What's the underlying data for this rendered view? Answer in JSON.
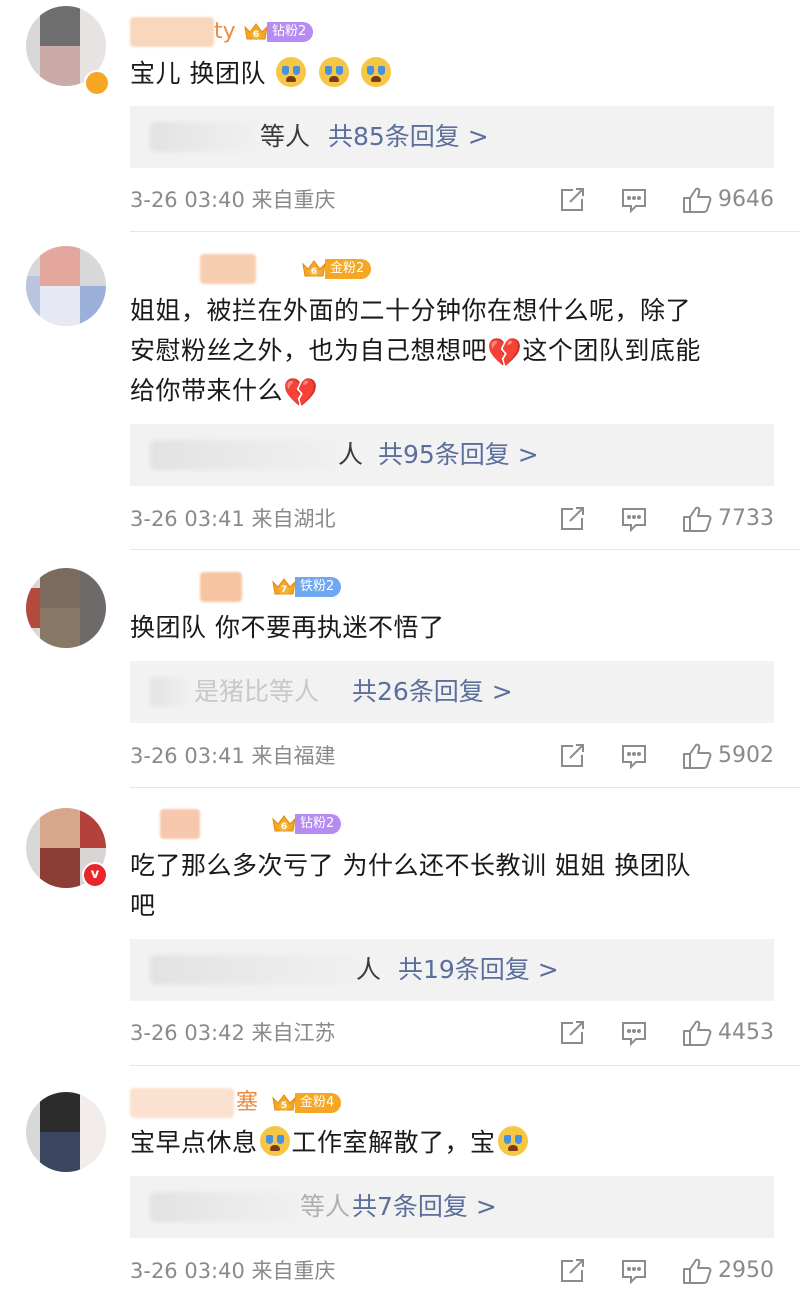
{
  "comments": [
    {
      "username_visible": "ty",
      "fan_badge": {
        "level": "6",
        "label": "钻粉2",
        "color": "#b68cf3",
        "crown": "#f5a623"
      },
      "text": "宝儿 换团队",
      "emojis": [
        "crying-face",
        "crying-face",
        "crying-face"
      ],
      "reply_suffix": "等人",
      "reply_link": "共85条回复 >",
      "time": "3-26 03:40 来自重庆",
      "likes": "9646"
    },
    {
      "username_visible": "",
      "fan_badge": {
        "level": "6",
        "label": "金粉2",
        "color": "#f5a623",
        "crown": "#f5a623"
      },
      "text_line1": "姐姐，被拦在外面的二十分钟你在想什么呢，除了",
      "text_line2a": "安慰粉丝之外，也为自己想想吧",
      "text_line2b": "这个团队到底能",
      "text_line3": "给你带来什么",
      "reply_suffix": "人",
      "reply_link": "共95条回复 >",
      "time": "3-26 03:41 来自湖北",
      "likes": "7733"
    },
    {
      "username_visible": "",
      "fan_badge": {
        "level": "7",
        "label": "铁粉2",
        "color": "#6fa8f0",
        "crown": "#f5a623"
      },
      "text": "换团队 你不要再执迷不悟了",
      "reply_suffix": "是猪比等人",
      "reply_link": "共26条回复 >",
      "time": "3-26 03:41 来自福建",
      "likes": "5902"
    },
    {
      "username_visible": "",
      "fan_badge": {
        "level": "6",
        "label": "钻粉2",
        "color": "#b68cf3",
        "crown": "#f5a623"
      },
      "text_line1": "吃了那么多次亏了 为什么还不长教训 姐姐 换团队",
      "text_line2": "吧",
      "reply_suffix": "人",
      "reply_link": "共19条回复 >",
      "time": "3-26 03:42 来自江苏",
      "likes": "4453"
    },
    {
      "username_visible": "塞",
      "fan_badge": {
        "level": "5",
        "label": "金粉4",
        "color": "#f5a623",
        "crown": "#f5a623"
      },
      "text_a": "宝早点休息",
      "text_b": "工作室解散了，宝",
      "reply_suffix": "等人",
      "reply_link": "共7条回复 >",
      "time": "3-26 03:40 来自重庆",
      "likes": "2950"
    }
  ]
}
